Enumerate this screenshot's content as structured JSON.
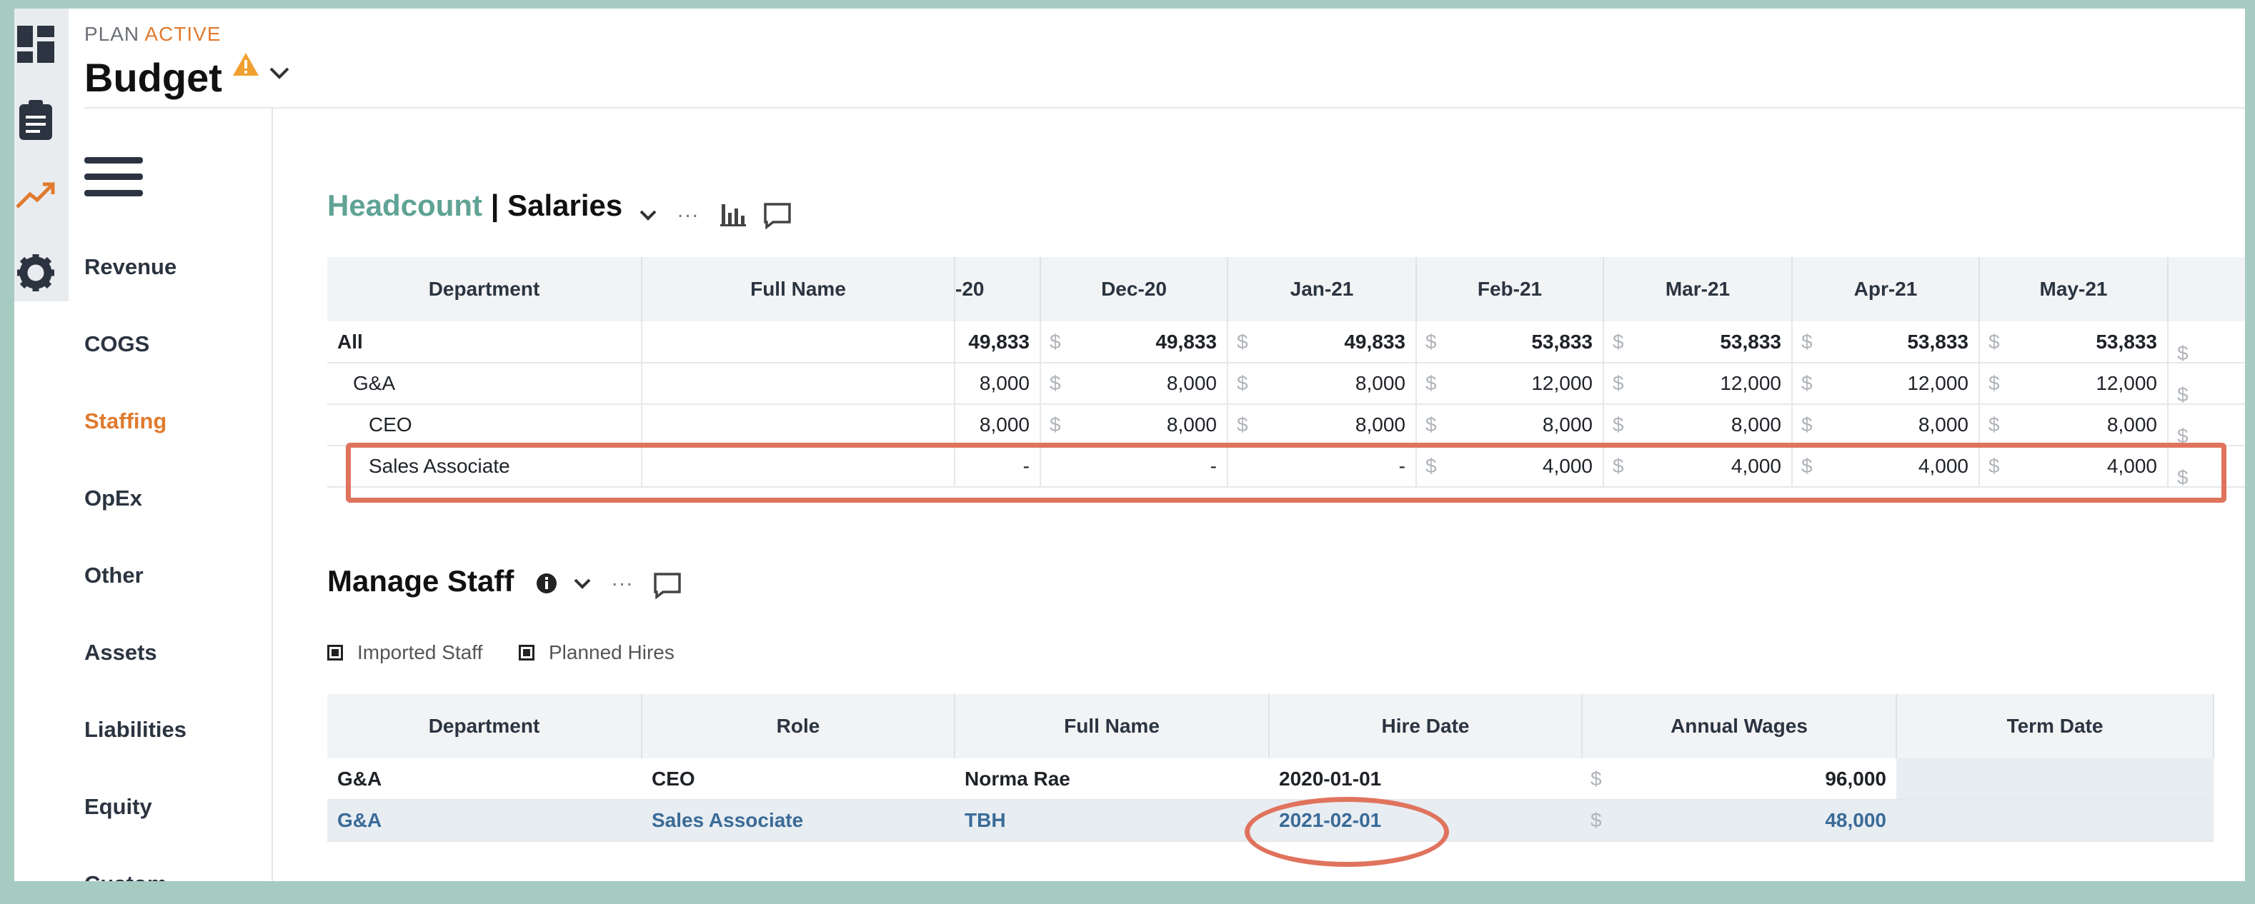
{
  "header": {
    "plan_prefix": "PLAN",
    "plan_status": "ACTIVE",
    "title": "Budget"
  },
  "rail_icons": [
    "dashboard-icon",
    "clipboard-icon",
    "trend-icon",
    "gear-icon"
  ],
  "nav": {
    "items": [
      "Revenue",
      "COGS",
      "Staffing",
      "OpEx",
      "Other",
      "Assets",
      "Liabilities",
      "Equity",
      "Custom"
    ],
    "selected": "Staffing"
  },
  "headcount": {
    "title_a": "Headcount",
    "separator": "|",
    "title_b": "Salaries",
    "ellipsis": "...",
    "columns": [
      "Department",
      "Full Name",
      "-20",
      "Dec-20",
      "Jan-21",
      "Feb-21",
      "Mar-21",
      "Apr-21",
      "May-21",
      ""
    ],
    "currency": "$",
    "rows": [
      {
        "dept": "All",
        "name": "",
        "values": [
          "49,833",
          "49,833",
          "49,833",
          "53,833",
          "53,833",
          "53,833",
          "53,833"
        ],
        "bold": true
      },
      {
        "dept": "G&A",
        "name": "",
        "values": [
          "8,000",
          "8,000",
          "8,000",
          "12,000",
          "12,000",
          "12,000",
          "12,000"
        ]
      },
      {
        "dept": "CEO",
        "name": "",
        "values": [
          "8,000",
          "8,000",
          "8,000",
          "8,000",
          "8,000",
          "8,000",
          "8,000"
        ]
      },
      {
        "dept": "Sales Associate",
        "name": "",
        "values": [
          "-",
          "-",
          "-",
          "4,000",
          "4,000",
          "4,000",
          "4,000"
        ]
      }
    ]
  },
  "manage_staff": {
    "title": "Manage Staff",
    "ellipsis": "...",
    "legend": [
      "Imported Staff",
      "Planned Hires"
    ],
    "columns": [
      "Department",
      "Role",
      "Full Name",
      "Hire Date",
      "Annual Wages",
      "Term Date"
    ],
    "currency": "$",
    "rows": [
      {
        "dept": "G&A",
        "role": "CEO",
        "name": "Norma Rae",
        "hire": "2020-01-01",
        "wages": "96,000",
        "term": ""
      },
      {
        "dept": "G&A",
        "role": "Sales Associate",
        "name": "TBH",
        "hire": "2021-02-01",
        "wages": "48,000",
        "term": ""
      }
    ]
  },
  "colors": {
    "accent_orange": "#e07a2e",
    "teal": "#5fa395",
    "annotation_red": "#e0735d",
    "planned_blue": "#3a6b98"
  }
}
